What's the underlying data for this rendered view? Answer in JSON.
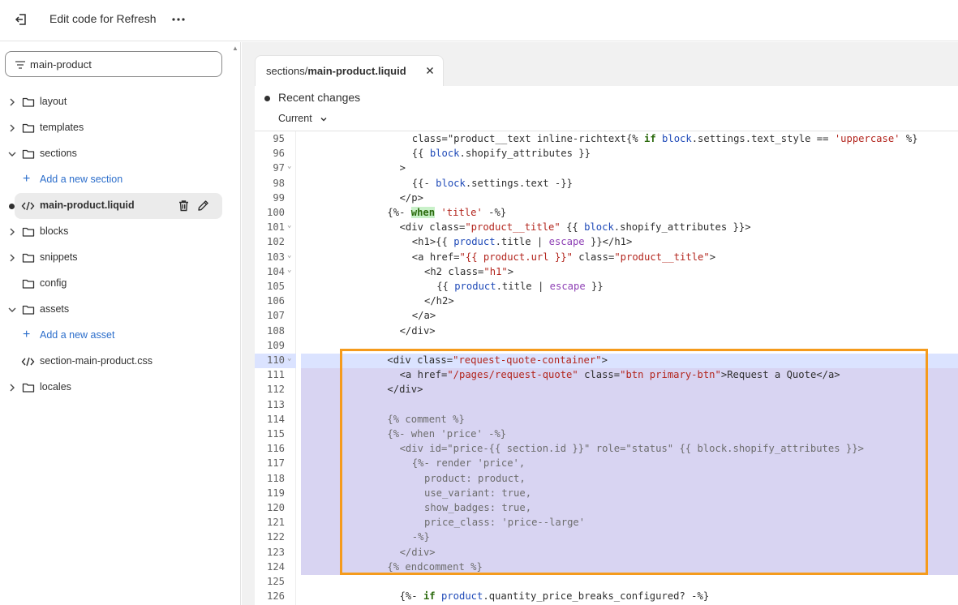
{
  "topbar": {
    "title": "Edit code for Refresh",
    "back_icon": "exit-icon",
    "more_icon": "ellipsis-icon"
  },
  "sidebar": {
    "search": {
      "value": "main-product",
      "icon": "filter-icon"
    },
    "tree": [
      {
        "type": "folder",
        "label": "layout",
        "expanded": false
      },
      {
        "type": "folder",
        "label": "templates",
        "expanded": false
      },
      {
        "type": "folder",
        "label": "sections",
        "expanded": true
      },
      {
        "type": "add",
        "label": "Add a new section"
      },
      {
        "type": "file",
        "label": "main-product.liquid",
        "active": true,
        "modified": true
      },
      {
        "type": "folder",
        "label": "blocks",
        "expanded": false
      },
      {
        "type": "folder",
        "label": "snippets",
        "expanded": false
      },
      {
        "type": "folder",
        "label": "config",
        "expanded": null
      },
      {
        "type": "folder",
        "label": "assets",
        "expanded": true
      },
      {
        "type": "add",
        "label": "Add a new asset"
      },
      {
        "type": "file",
        "label": "section-main-product.css"
      },
      {
        "type": "folder",
        "label": "locales",
        "expanded": false
      }
    ]
  },
  "editor": {
    "tab": {
      "path_prefix": "sections/",
      "file": "main-product.liquid"
    },
    "changes": {
      "title": "Recent changes",
      "version": "Current"
    },
    "accent_highlight": "#d8d4f2",
    "annotation_color": "#f59b1c",
    "lines": [
      {
        "n": "95",
        "fold": false,
        "indent": 9,
        "code": "class=\"product__text inline-richtext{% if block.settings.text_style == 'uppercase' %}"
      },
      {
        "n": "96",
        "fold": false,
        "indent": 9,
        "code": "{{ block.shopify_attributes }}"
      },
      {
        "n": "97",
        "fold": true,
        "indent": 8,
        "code": ">"
      },
      {
        "n": "98",
        "fold": false,
        "indent": 9,
        "code": "{{- block.settings.text -}}"
      },
      {
        "n": "99",
        "fold": false,
        "indent": 8,
        "code": "</p>"
      },
      {
        "n": "100",
        "fold": false,
        "indent": 7,
        "code": "{%- when 'title' -%}"
      },
      {
        "n": "101",
        "fold": true,
        "indent": 8,
        "code": "<div class=\"product__title\" {{ block.shopify_attributes }}>"
      },
      {
        "n": "102",
        "fold": false,
        "indent": 9,
        "code": "<h1>{{ product.title | escape }}</h1>"
      },
      {
        "n": "103",
        "fold": true,
        "indent": 9,
        "code": "<a href=\"{{ product.url }}\" class=\"product__title\">"
      },
      {
        "n": "104",
        "fold": true,
        "indent": 10,
        "code": "<h2 class=\"h1\">"
      },
      {
        "n": "105",
        "fold": false,
        "indent": 11,
        "code": "{{ product.title | escape }}"
      },
      {
        "n": "106",
        "fold": false,
        "indent": 10,
        "code": "</h2>"
      },
      {
        "n": "107",
        "fold": false,
        "indent": 9,
        "code": "</a>"
      },
      {
        "n": "108",
        "fold": false,
        "indent": 8,
        "code": "</div>"
      },
      {
        "n": "109",
        "fold": false,
        "indent": 0,
        "code": ""
      },
      {
        "n": "110",
        "fold": true,
        "indent": 7,
        "code": "<div class=\"request-quote-container\">",
        "current": true
      },
      {
        "n": "111",
        "fold": false,
        "indent": 8,
        "code": "<a href=\"/pages/request-quote\" class=\"btn primary-btn\">Request a Quote</a>",
        "hl": true
      },
      {
        "n": "112",
        "fold": false,
        "indent": 7,
        "code": "</div>",
        "hl": true
      },
      {
        "n": "113",
        "fold": false,
        "indent": 0,
        "code": "",
        "hl": true
      },
      {
        "n": "114",
        "fold": false,
        "indent": 7,
        "code": "{% comment %}",
        "hl": true,
        "comment": true
      },
      {
        "n": "115",
        "fold": false,
        "indent": 7,
        "code": "{%- when 'price' -%}",
        "hl": true,
        "comment": true
      },
      {
        "n": "116",
        "fold": false,
        "indent": 8,
        "code": "<div id=\"price-{{ section.id }}\" role=\"status\" {{ block.shopify_attributes }}>",
        "hl": true,
        "comment": true
      },
      {
        "n": "117",
        "fold": false,
        "indent": 9,
        "code": "{%- render 'price',",
        "hl": true,
        "comment": true
      },
      {
        "n": "118",
        "fold": false,
        "indent": 10,
        "code": "product: product,",
        "hl": true,
        "comment": true
      },
      {
        "n": "119",
        "fold": false,
        "indent": 10,
        "code": "use_variant: true,",
        "hl": true,
        "comment": true
      },
      {
        "n": "120",
        "fold": false,
        "indent": 10,
        "code": "show_badges: true,",
        "hl": true,
        "comment": true
      },
      {
        "n": "121",
        "fold": false,
        "indent": 10,
        "code": "price_class: 'price--large'",
        "hl": true,
        "comment": true
      },
      {
        "n": "122",
        "fold": false,
        "indent": 9,
        "code": "-%}",
        "hl": true,
        "comment": true
      },
      {
        "n": "123",
        "fold": false,
        "indent": 8,
        "code": "</div>",
        "hl": true,
        "comment": true
      },
      {
        "n": "124",
        "fold": false,
        "indent": 7,
        "code": "{% endcomment %}",
        "hl": true,
        "comment": true
      },
      {
        "n": "125",
        "fold": false,
        "indent": 0,
        "code": ""
      },
      {
        "n": "126",
        "fold": false,
        "indent": 8,
        "code": "{%- if product.quantity_price_breaks_configured? -%}"
      }
    ]
  }
}
